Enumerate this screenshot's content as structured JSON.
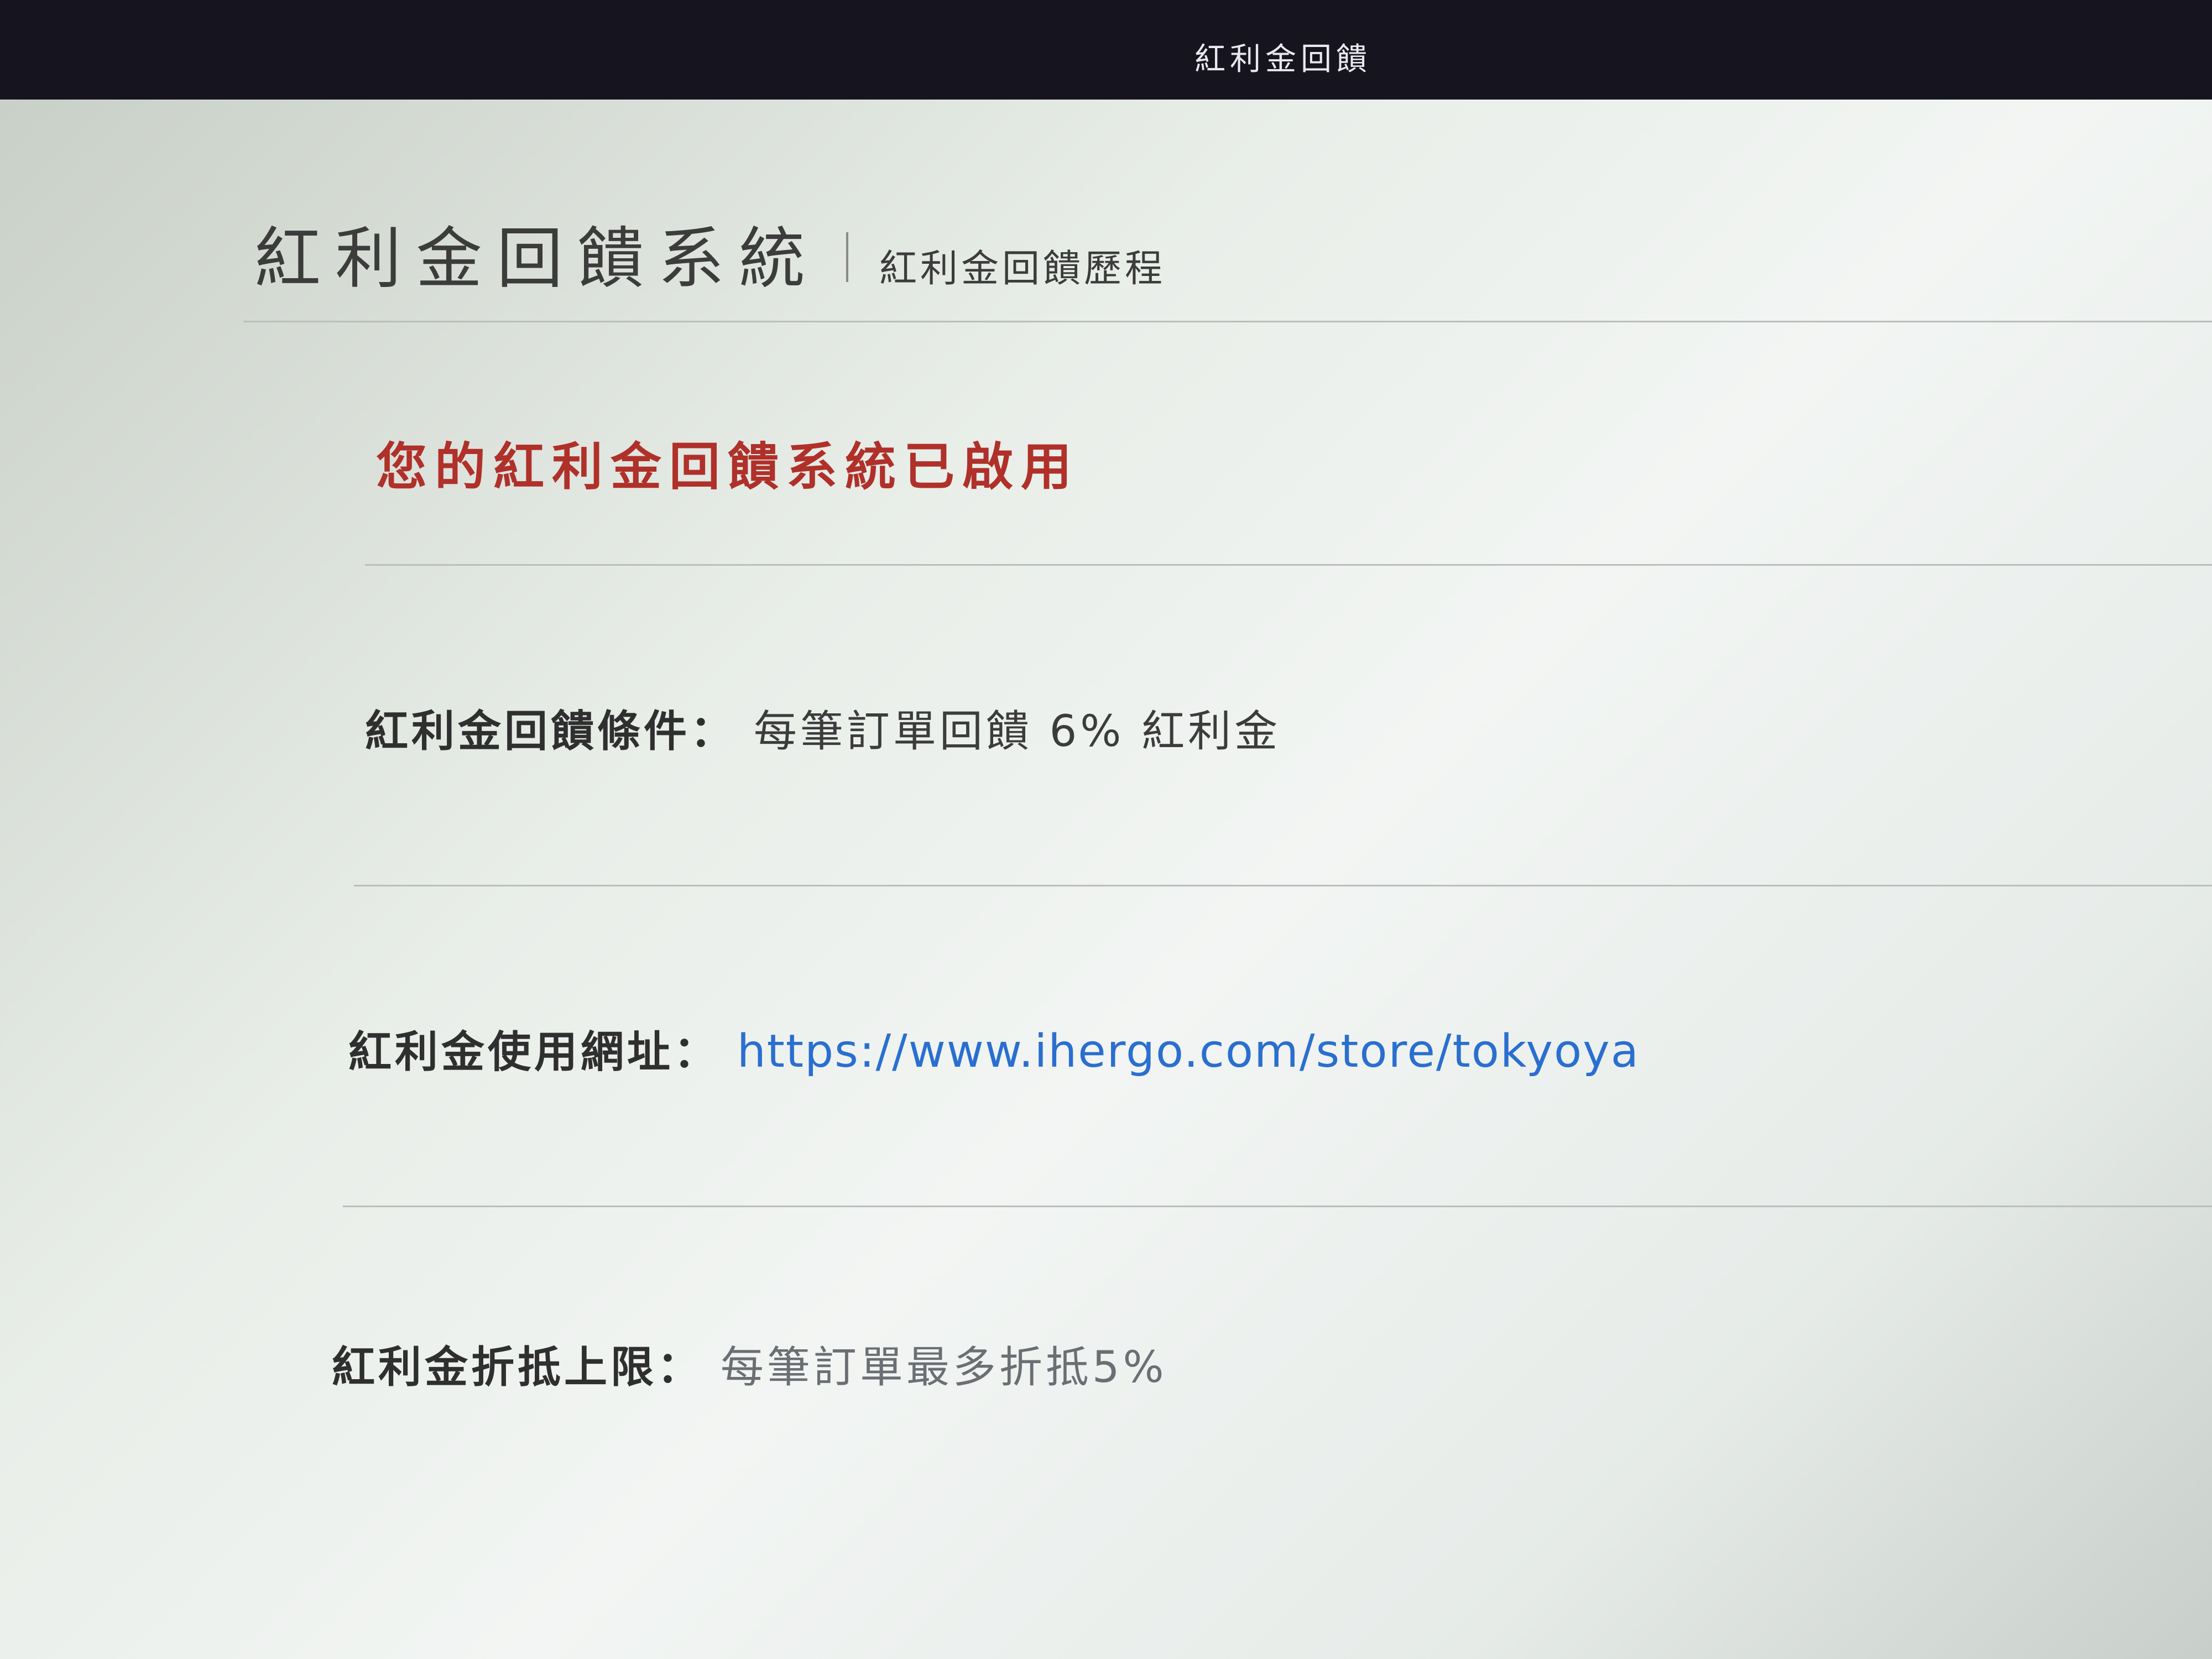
{
  "window": {
    "title": "紅利金回饋"
  },
  "header": {
    "title": "紅利金回饋系統",
    "subtitle_link": "紅利金回饋歷程"
  },
  "status": {
    "message": "您的紅利金回饋系統已啟用"
  },
  "rows": [
    {
      "label": "紅利金回饋條件：",
      "value": "每筆訂單回饋 6% 紅利金"
    },
    {
      "label": "紅利金使用網址：",
      "value": "https://www.ihergo.com/store/tokyoya"
    },
    {
      "label": "紅利金折抵上限：",
      "value": "每筆訂單最多折抵5%"
    }
  ],
  "colors": {
    "status_red": "#b0302a",
    "link_blue": "#2a6fd0",
    "topbar": "#16141f"
  }
}
